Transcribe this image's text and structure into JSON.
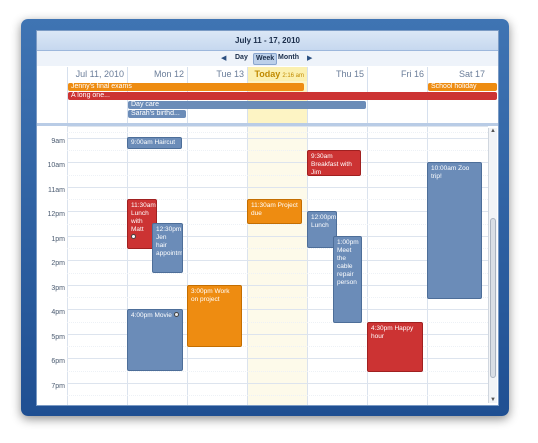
{
  "title": "July 11 - 17, 2010",
  "nav": {
    "prev": "◀",
    "next": "▶",
    "day": "Day",
    "week": "Week",
    "month": "Month"
  },
  "days": [
    {
      "label": "Jul 11, 2010"
    },
    {
      "label": "Mon 12"
    },
    {
      "label": "Tue 13"
    },
    {
      "label": "Today",
      "time": "2:16 am"
    },
    {
      "label": "Thu 15"
    },
    {
      "label": "Fri 16"
    },
    {
      "label": "Sat 17"
    }
  ],
  "allday_events": [
    {
      "title": "Jenny's final exams",
      "color": "#ee8c11"
    },
    {
      "title": "A long one...",
      "color": "#cc3333"
    },
    {
      "title": "Day care",
      "color": "#6b8cb8"
    },
    {
      "title": "Sarah's birthd...",
      "color": "#6b8cb8"
    },
    {
      "title": "School holiday",
      "color": "#ee8c11"
    }
  ],
  "hours": [
    "9am",
    "10am",
    "11am",
    "12pm",
    "1pm",
    "2pm",
    "3pm",
    "4pm",
    "5pm",
    "6pm",
    "7pm"
  ],
  "events": [
    {
      "text": "9:00am Haircut"
    },
    {
      "text": "9:30am Breakfast with Jim"
    },
    {
      "text": "10:00am Zoo trip!"
    },
    {
      "text": "11:30am Project due"
    },
    {
      "text": "11:30am Lunch with Matt"
    },
    {
      "text": "12:30pm Jen hair appointm..."
    },
    {
      "text": "12:00pm Lunch"
    },
    {
      "text": "1:00pm Meet the cable repair person"
    },
    {
      "text": "3:00pm Work on project"
    },
    {
      "text": "4:00pm Movie"
    },
    {
      "text": "4:30pm Happy hour"
    }
  ]
}
